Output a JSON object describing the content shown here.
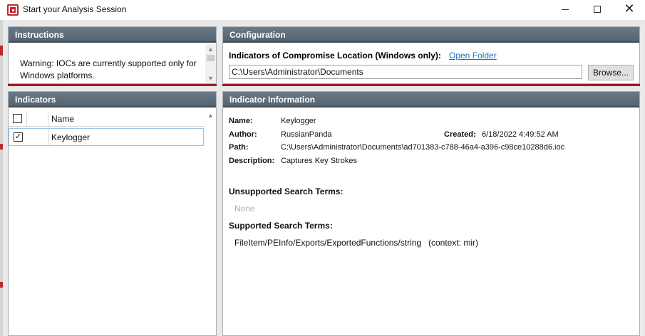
{
  "window": {
    "title": "Start your Analysis Session",
    "minimize_glyph": "—",
    "close_glyph": "✕"
  },
  "instructions": {
    "header": "Instructions",
    "text": "Warning: IOCs are currently supported only for Windows platforms."
  },
  "configuration": {
    "header": "Configuration",
    "location_label": "Indicators of Compromise Location (Windows only):",
    "open_folder_link": "Open Folder",
    "path_value": "C:\\Users\\Administrator\\Documents",
    "browse_button": "Browse..."
  },
  "indicators": {
    "header": "Indicators",
    "column_name": "Name",
    "rows": [
      {
        "name": "Keylogger",
        "checked": true,
        "check_glyph": "✓"
      }
    ]
  },
  "indicator_info": {
    "header": "Indicator Information",
    "name_label": "Name:",
    "name_value": "Keylogger",
    "author_label": "Author:",
    "author_value": "RussianPanda",
    "created_label": "Created:",
    "created_value": "6/18/2022 4:49:52 AM",
    "path_label": "Path:",
    "path_value": "C:\\Users\\Administrator\\Documents\\ad701383-c788-46a4-a396-c98ce10288d6.ioc",
    "description_label": "Description:",
    "description_value": "Captures Key Strokes",
    "unsupported_heading": "Unsupported Search Terms:",
    "unsupported_value": "None",
    "supported_heading": "Supported Search Terms:",
    "supported_term": "FileItem/PEInfo/Exports/ExportedFunctions/string",
    "supported_context": "(context: mir)"
  },
  "colors": {
    "panel_header": "#5f6d7a",
    "accent_red": "#9b1f1f",
    "link_blue": "#1a6fc4"
  }
}
